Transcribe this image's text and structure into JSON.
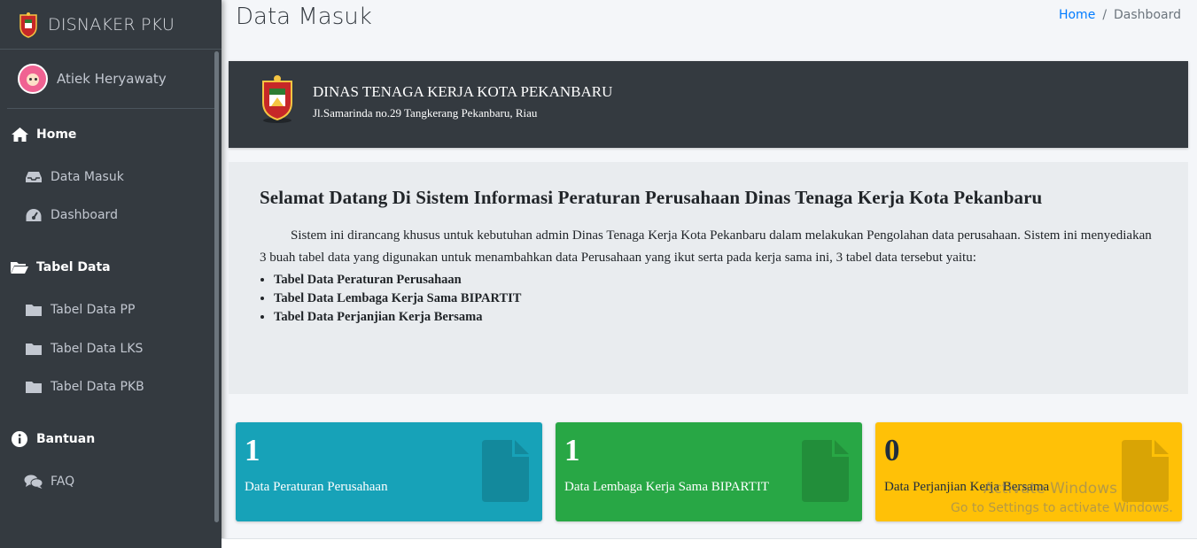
{
  "brand": {
    "name": "DISNAKER PKU",
    "logo_icon": "coat-of-arms-icon"
  },
  "user": {
    "name": "Atiek Heryawaty",
    "avatar_icon": "user-avatar-icon"
  },
  "sidebar": {
    "items": [
      {
        "label": "Home",
        "icon": "home-icon"
      },
      {
        "label": "Data Masuk",
        "icon": "inbox-icon"
      },
      {
        "label": "Dashboard",
        "icon": "tachometer-icon"
      },
      {
        "label": "Tabel Data",
        "icon": "folder-open-icon"
      },
      {
        "label": "Tabel Data PP",
        "icon": "folder-icon"
      },
      {
        "label": "Tabel Data LKS",
        "icon": "folder-icon"
      },
      {
        "label": "Tabel Data PKB",
        "icon": "folder-icon"
      },
      {
        "label": "Bantuan",
        "icon": "info-circle-icon"
      },
      {
        "label": "FAQ",
        "icon": "comments-icon"
      }
    ]
  },
  "header": {
    "title": "Data Masuk",
    "breadcrumb": {
      "home": "Home",
      "separator": "/",
      "current": "Dashboard"
    }
  },
  "banner": {
    "title": "DINAS TENAGA KERJA KOTA PEKANBARU",
    "address": "Jl.Samarinda no.29 Tangkerang Pekanbaru, Riau"
  },
  "welcome": {
    "heading": "Selamat Datang Di Sistem Informasi Peraturan Perusahaan Dinas Tenaga Kerja Kota Pekanbaru",
    "paragraph": "Sistem ini dirancang khusus untuk kebutuhan admin Dinas Tenaga Kerja Kota Pekanbaru dalam melakukan Pengolahan data perusahaan. Sistem ini menyediakan 3 buah tabel data yang digunakan untuk menambahkan data Perusahaan yang ikut serta pada kerja sama ini, 3 tabel data tersebut yaitu:",
    "list": [
      "Tabel Data Peraturan Perusahaan",
      "Tabel Data Lembaga Kerja Sama BIPARTIT",
      "Tabel Data Perjanjian Kerja Bersama"
    ]
  },
  "stats": [
    {
      "value": "1",
      "label": "Data Peraturan Perusahaan",
      "color": "#17a2b8",
      "icon": "file-icon"
    },
    {
      "value": "1",
      "label": "Data Lembaga Kerja Sama BIPARTIT",
      "color": "#28a745",
      "icon": "file-icon"
    },
    {
      "value": "0",
      "label": "Data Perjanjian Kerja Bersama",
      "color": "#ffc107",
      "icon": "file-icon"
    }
  ],
  "watermark": {
    "line1": "Activate Windows",
    "line2": "Go to Settings to activate Windows."
  }
}
